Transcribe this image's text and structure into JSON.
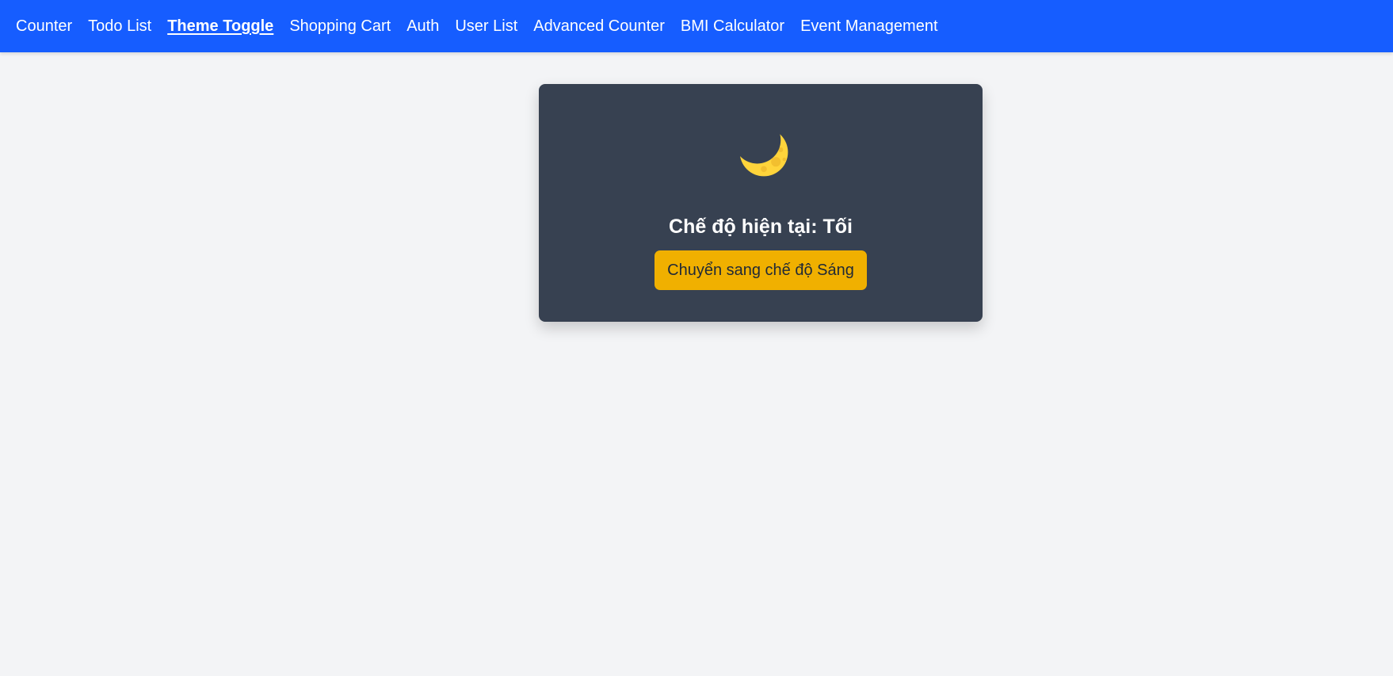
{
  "nav": {
    "items": [
      {
        "label": "Counter"
      },
      {
        "label": "Todo List"
      },
      {
        "label": "Theme Toggle"
      },
      {
        "label": "Shopping Cart"
      },
      {
        "label": "Auth"
      },
      {
        "label": "User List"
      },
      {
        "label": "Advanced Counter"
      },
      {
        "label": "BMI Calculator"
      },
      {
        "label": "Event Management"
      }
    ],
    "active": "Theme Toggle"
  },
  "theme_card": {
    "icon": "crescent-moon-icon",
    "title": "Chế độ hiện tại: Tối",
    "button_label": "Chuyển sang chế độ Sáng"
  },
  "colors": {
    "navbar": "#165dff",
    "page_background": "#f3f4f6",
    "card_background": "#374151",
    "button_background": "#f0b000",
    "moon": "#ffd43b"
  }
}
